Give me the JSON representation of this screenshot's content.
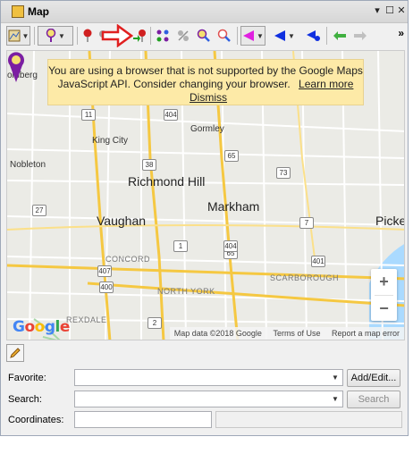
{
  "window": {
    "title": "Map"
  },
  "toolbar": {
    "icons": [
      "map-layers-icon",
      "pin-select-icon",
      "red-pin-icon",
      "gray-pin-icon",
      "red-arrow-icon",
      "pin-arrow-icon",
      "route-icon",
      "split-icon",
      "zoom-pin-icon",
      "magnify-pin-icon",
      "magenta-back-icon",
      "blue-back-icon",
      "blue-forward-icon",
      "green-back-icon",
      "gray-forward-icon"
    ]
  },
  "map": {
    "banner": {
      "message": "You are using a browser that is not supported by the Google Maps JavaScript API. Consider changing your browser.",
      "learn_more": "Learn more",
      "dismiss": "Dismiss"
    },
    "places": {
      "bramberg": "omberg",
      "king_city": "King City",
      "gormley": "Gormley",
      "nobleton": "Nobleton",
      "richmond_hill": "Richmond Hill",
      "vaughan": "Vaughan",
      "markham": "Markham",
      "pickering": "Picker",
      "concord": "CONCORD",
      "north_york": "NORTH YORK",
      "scarborough": "SCARBOROUGH",
      "rexdale": "REXDALE"
    },
    "shields": {
      "r11": "11",
      "r404a": "404",
      "r38": "38",
      "r65a": "65",
      "r73": "73",
      "r27": "27",
      "r7": "7",
      "r65b": "65",
      "r1": "1",
      "r404b": "404",
      "r407": "407",
      "r400": "400",
      "r401": "401",
      "r2": "2"
    },
    "logo": "Google",
    "attribution": {
      "data": "Map data ©2018 Google",
      "terms": "Terms of Use",
      "report": "Report a map error"
    },
    "zoom_in": "+",
    "zoom_out": "−"
  },
  "form": {
    "favorite_label": "Favorite:",
    "favorite_value": "",
    "add_edit": "Add/Edit...",
    "search_label": "Search:",
    "search_value": "",
    "search_button": "Search",
    "coordinates_label": "Coordinates:",
    "coordinates_value": ""
  },
  "colors": {
    "banner": "#fdeaa7",
    "pin": "#7b1fa2",
    "arrow": "#e02020"
  }
}
